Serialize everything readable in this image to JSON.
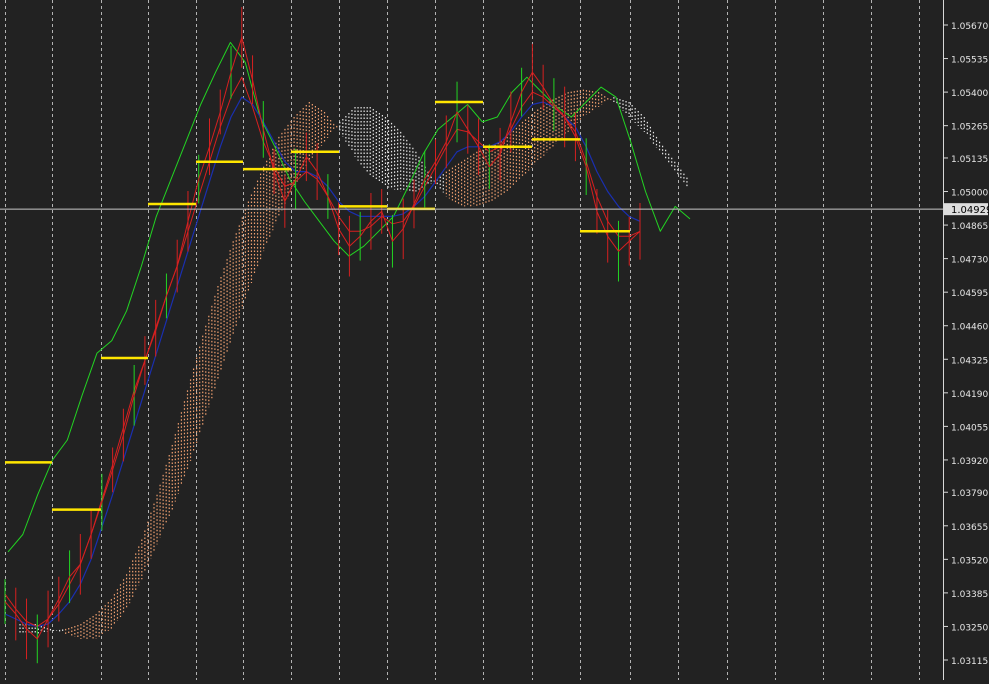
{
  "chart_data": {
    "type": "line",
    "description": "Forex candlestick-style price chart with Ichimoku cloud, Tenkan/Kijun lines, Chikou span and daily horizontal levels",
    "y_axis": {
      "ticks": [
        "1.05670",
        "1.05535",
        "1.05400",
        "1.05265",
        "1.05135",
        "1.05000",
        "1.04865",
        "1.04730",
        "1.04595",
        "1.04460",
        "1.04325",
        "1.04190",
        "1.04055",
        "1.03920",
        "1.03790",
        "1.03655",
        "1.03520",
        "1.03385",
        "1.03250",
        "1.03115"
      ],
      "ylim": [
        1.0306,
        1.0575
      ],
      "current_price_label": "1.04929",
      "current_price": 1.04929
    },
    "grid": {
      "vertical_dashed": true,
      "horizontal": false,
      "separator_count": 15
    },
    "colors": {
      "background": "#222222",
      "price": "#d62020",
      "tenkan": "#d62020",
      "kijun": "#1a2fb0",
      "chikou": "#22d422",
      "cloud_bull": "#f0a070",
      "cloud_bear": "#e8e8e8",
      "level": "#ffe600",
      "grid": "#d8d8d8",
      "current_line": "#c8c8c8"
    },
    "series": [
      {
        "role": "price",
        "values": [
          1.0335,
          1.033,
          1.0324,
          1.032,
          1.0328,
          1.0336,
          1.0345,
          1.035,
          1.0362,
          1.0375,
          1.0388,
          1.0402,
          1.0418,
          1.0432,
          1.0445,
          1.0458,
          1.047,
          1.0488,
          1.0505,
          1.0518,
          1.0532,
          1.0548,
          1.0562,
          1.0545,
          1.0525,
          1.0508,
          1.0496,
          1.0505,
          1.0514,
          1.0508,
          1.0498,
          1.0485,
          1.0478,
          1.0482,
          1.0488,
          1.0492,
          1.048,
          1.0485,
          1.0495,
          1.0505,
          1.0512,
          1.052,
          1.0532,
          1.0525,
          1.0518,
          1.051,
          1.0515,
          1.0528,
          1.054,
          1.0548,
          1.0542,
          1.0535,
          1.053,
          1.0522,
          1.051,
          1.0492,
          1.0482,
          1.0476,
          1.048,
          1.0484
        ]
      },
      {
        "role": "tenkan",
        "values": [
          1.0338,
          1.0332,
          1.0327,
          1.0325,
          1.0328,
          1.0334,
          1.0342,
          1.035,
          1.0362,
          1.0376,
          1.039,
          1.0405,
          1.042,
          1.0432,
          1.0444,
          1.0458,
          1.047,
          1.0484,
          1.0498,
          1.0512,
          1.0526,
          1.0538,
          1.0546,
          1.0534,
          1.052,
          1.051,
          1.0502,
          1.0504,
          1.0508,
          1.0505,
          1.0498,
          1.049,
          1.0484,
          1.0484,
          1.0486,
          1.049,
          1.0487,
          1.0488,
          1.0494,
          1.0502,
          1.051,
          1.0518,
          1.0525,
          1.0524,
          1.052,
          1.0516,
          1.0518,
          1.0525,
          1.0534,
          1.054,
          1.0538,
          1.0534,
          1.053,
          1.0524,
          1.0512,
          1.0498,
          1.0488,
          1.0482,
          1.0482,
          1.0484
        ]
      },
      {
        "role": "kijun",
        "values": [
          1.033,
          1.0328,
          1.0326,
          1.0325,
          1.0326,
          1.033,
          1.0335,
          1.0342,
          1.0352,
          1.0365,
          1.0378,
          1.0392,
          1.0406,
          1.042,
          1.0434,
          1.0448,
          1.0462,
          1.0476,
          1.049,
          1.0504,
          1.0518,
          1.053,
          1.0538,
          1.0535,
          1.0528,
          1.052,
          1.0512,
          1.0508,
          1.0508,
          1.0506,
          1.0502,
          1.0496,
          1.0492,
          1.049,
          1.049,
          1.049,
          1.049,
          1.0491,
          1.0494,
          1.0498,
          1.0504,
          1.051,
          1.0516,
          1.0518,
          1.0518,
          1.0518,
          1.052,
          1.0524,
          1.053,
          1.0535,
          1.0536,
          1.0534,
          1.053,
          1.0526,
          1.0518,
          1.0508,
          1.05,
          1.0494,
          1.049,
          1.0488
        ]
      },
      {
        "role": "chikou",
        "values": [
          1.0355,
          1.0362,
          1.0378,
          1.0392,
          1.04,
          1.0418,
          1.0435,
          1.044,
          1.0452,
          1.047,
          1.049,
          1.0505,
          1.052,
          1.0535,
          1.0548,
          1.056,
          1.0552,
          1.053,
          1.0518,
          1.0505,
          1.0496,
          1.0488,
          1.048,
          1.0474,
          1.0478,
          1.0484,
          1.049,
          1.0502,
          1.0515,
          1.0525,
          1.053,
          1.0535,
          1.0528,
          1.053,
          1.054,
          1.0546,
          1.054,
          1.0534,
          1.053,
          1.0536,
          1.0542,
          1.0538,
          1.052,
          1.05,
          1.0484,
          1.0494,
          1.0489
        ]
      },
      {
        "role": "senkou_a",
        "values": [
          1.0322,
          1.0322,
          1.0323,
          1.0324,
          1.0326,
          1.033,
          1.0336,
          1.0346,
          1.036,
          1.0378,
          1.0398,
          1.042,
          1.0442,
          1.0462,
          1.048,
          1.0496,
          1.051,
          1.0522,
          1.053,
          1.0536,
          1.0532,
          1.0524,
          1.0514,
          1.0506,
          1.0502,
          1.05,
          1.05,
          1.0503,
          1.0508,
          1.0512,
          1.0516,
          1.0518,
          1.0522,
          1.0528,
          1.0533,
          1.0537,
          1.054,
          1.0541,
          1.054,
          1.0536,
          1.053,
          1.0524,
          1.0516,
          1.0508,
          1.05
        ]
      },
      {
        "role": "senkou_b",
        "values": [
          1.0326,
          1.0326,
          1.0324,
          1.0322,
          1.032,
          1.032,
          1.0324,
          1.0332,
          1.0344,
          1.0358,
          1.0372,
          1.0388,
          1.0406,
          1.0424,
          1.0442,
          1.046,
          1.0476,
          1.049,
          1.0502,
          1.0512,
          1.052,
          1.0528,
          1.0534,
          1.0534,
          1.053,
          1.0524,
          1.0516,
          1.0506,
          1.0498,
          1.0494,
          1.0494,
          1.0496,
          1.05,
          1.0506,
          1.0512,
          1.0518,
          1.0524,
          1.053,
          1.0534,
          1.0538,
          1.0536,
          1.053,
          1.052,
          1.0512,
          1.0504
        ]
      }
    ],
    "levels": [
      1.0391,
      1.0372,
      1.0433,
      1.0495,
      1.0512,
      1.0509,
      1.0516,
      1.0494,
      1.0493,
      1.0536,
      1.0518,
      1.0521,
      1.0484
    ]
  }
}
